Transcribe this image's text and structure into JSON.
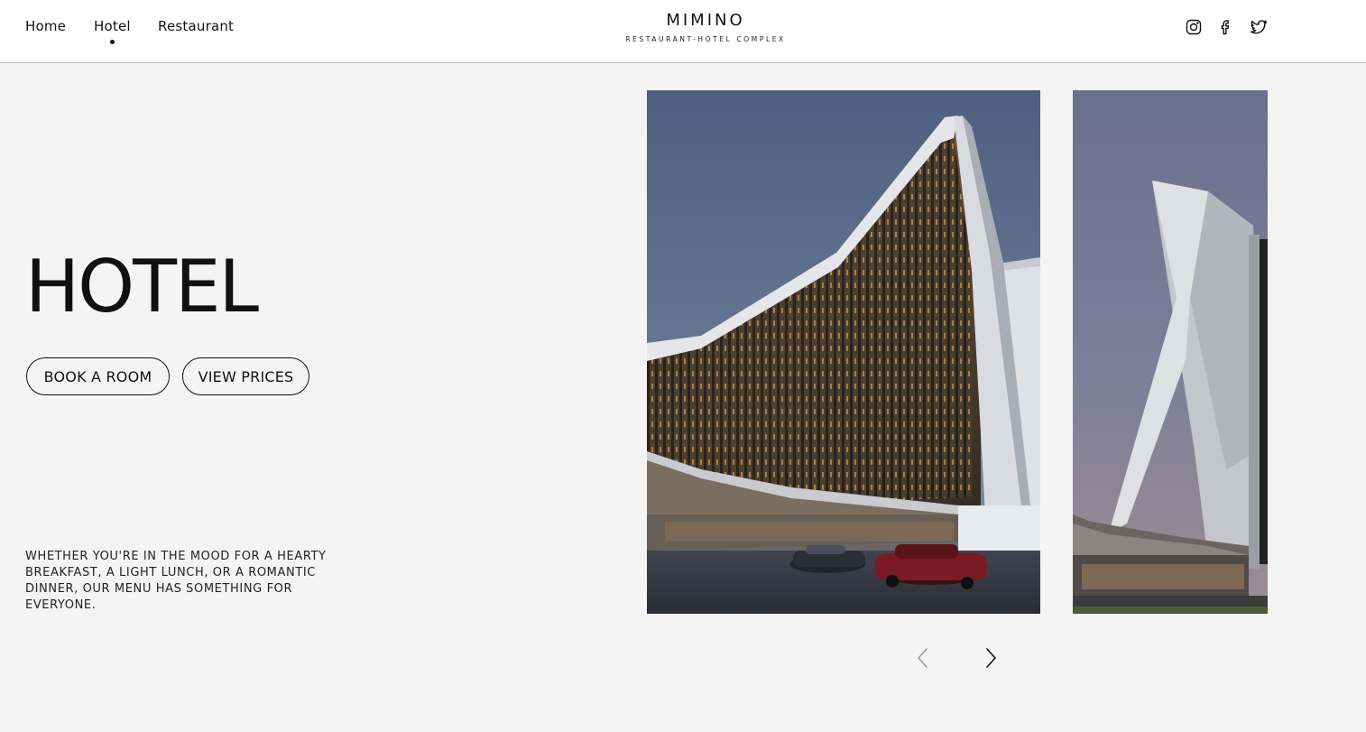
{
  "nav": {
    "items": [
      {
        "label": "Home",
        "active": false
      },
      {
        "label": "Hotel",
        "active": true
      },
      {
        "label": "Restaurant",
        "active": false
      }
    ]
  },
  "brand": {
    "name": "MIMINO",
    "tagline": "RESTAURANT-HOTEL COMPLEX"
  },
  "social": [
    "instagram-icon",
    "facebook-icon",
    "twitter-icon"
  ],
  "hero": {
    "title": "HOTEL",
    "primary_button": "BOOK A ROOM",
    "secondary_button": "VIEW PRICES",
    "description": "WHETHER YOU'RE IN THE MOOD FOR A HEARTY BREAKFAST, A LIGHT LUNCH, OR A ROMANTIC DINNER, OUR MENU HAS SOMETHING FOR EVERYONE."
  },
  "carousel": {
    "prev_enabled": false,
    "next_enabled": true
  },
  "colors": {
    "page_bg": "#f4f4f4",
    "header_bg": "#ffffff",
    "text": "#111111",
    "arrow_disabled": "#9a9a9a"
  }
}
